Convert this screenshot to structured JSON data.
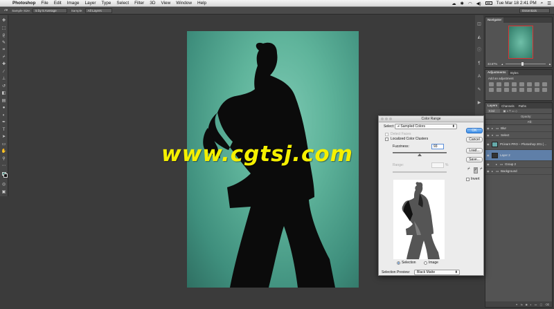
{
  "menubar": {
    "app": "Photoshop",
    "items": [
      "File",
      "Edit",
      "Image",
      "Layer",
      "Type",
      "Select",
      "Filter",
      "3D",
      "View",
      "Window",
      "Help"
    ],
    "clock": "Tue Mar 18  2:41 PM"
  },
  "options": {
    "sample_size_label": "Sample Size:",
    "sample_size_value": "5 by 5 Average",
    "sample_label": "Sample:",
    "sample_value": "All Layers",
    "workspace": "Essentials"
  },
  "navigator": {
    "tabs": [
      "Navigator"
    ],
    "zoom": "33.67%"
  },
  "adjustments": {
    "tabs": [
      "Adjustments",
      "Styles"
    ],
    "add_label": "Add an adjustment"
  },
  "layers_panel": {
    "tabs": [
      "Layers",
      "Channels",
      "Paths"
    ],
    "kind": "Kind",
    "opacity_label": "Opacity:",
    "fill_label": "Fill:",
    "layers": [
      {
        "name": "Blur"
      },
      {
        "name": "Select"
      },
      {
        "name": "Pt.learn PRO – Photoshop 201 (…"
      },
      {
        "name": "Layer 2"
      },
      {
        "name": "Group 2"
      },
      {
        "name": "Background"
      }
    ]
  },
  "dialog": {
    "title": "Color Range",
    "select_label": "Select:",
    "select_value": "Sampled Colors",
    "detect_faces": "Detect Faces",
    "localized": "Localized Color Clusters",
    "fuzziness_label": "Fuzziness:",
    "fuzziness_value": "93",
    "range_label": "Range:",
    "range_unit": "%",
    "selection_option": "Selection",
    "image_option": "Image",
    "preview_label": "Selection Preview:",
    "preview_value": "Black Matte",
    "ok": "OK",
    "cancel": "Cancel",
    "load": "Load...",
    "save": "Save...",
    "invert": "Invert"
  },
  "watermark": "www.cgtsj.com"
}
